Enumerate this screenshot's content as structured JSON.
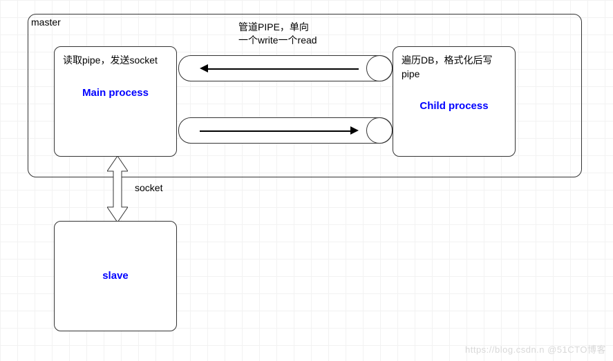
{
  "master": {
    "label": "master",
    "mainProcess": {
      "desc": "读取pipe，发送socket",
      "title": "Main process"
    },
    "childProcess": {
      "desc": "遍历DB，格式化后写pipe",
      "title": "Child process"
    },
    "pipeLabel": {
      "line1": "管道PIPE，单向",
      "line2": "一个write一个read"
    }
  },
  "socketLabel": "socket",
  "slave": {
    "title": "slave"
  },
  "watermark": "https://blog.csdn.n @51CTO博客"
}
